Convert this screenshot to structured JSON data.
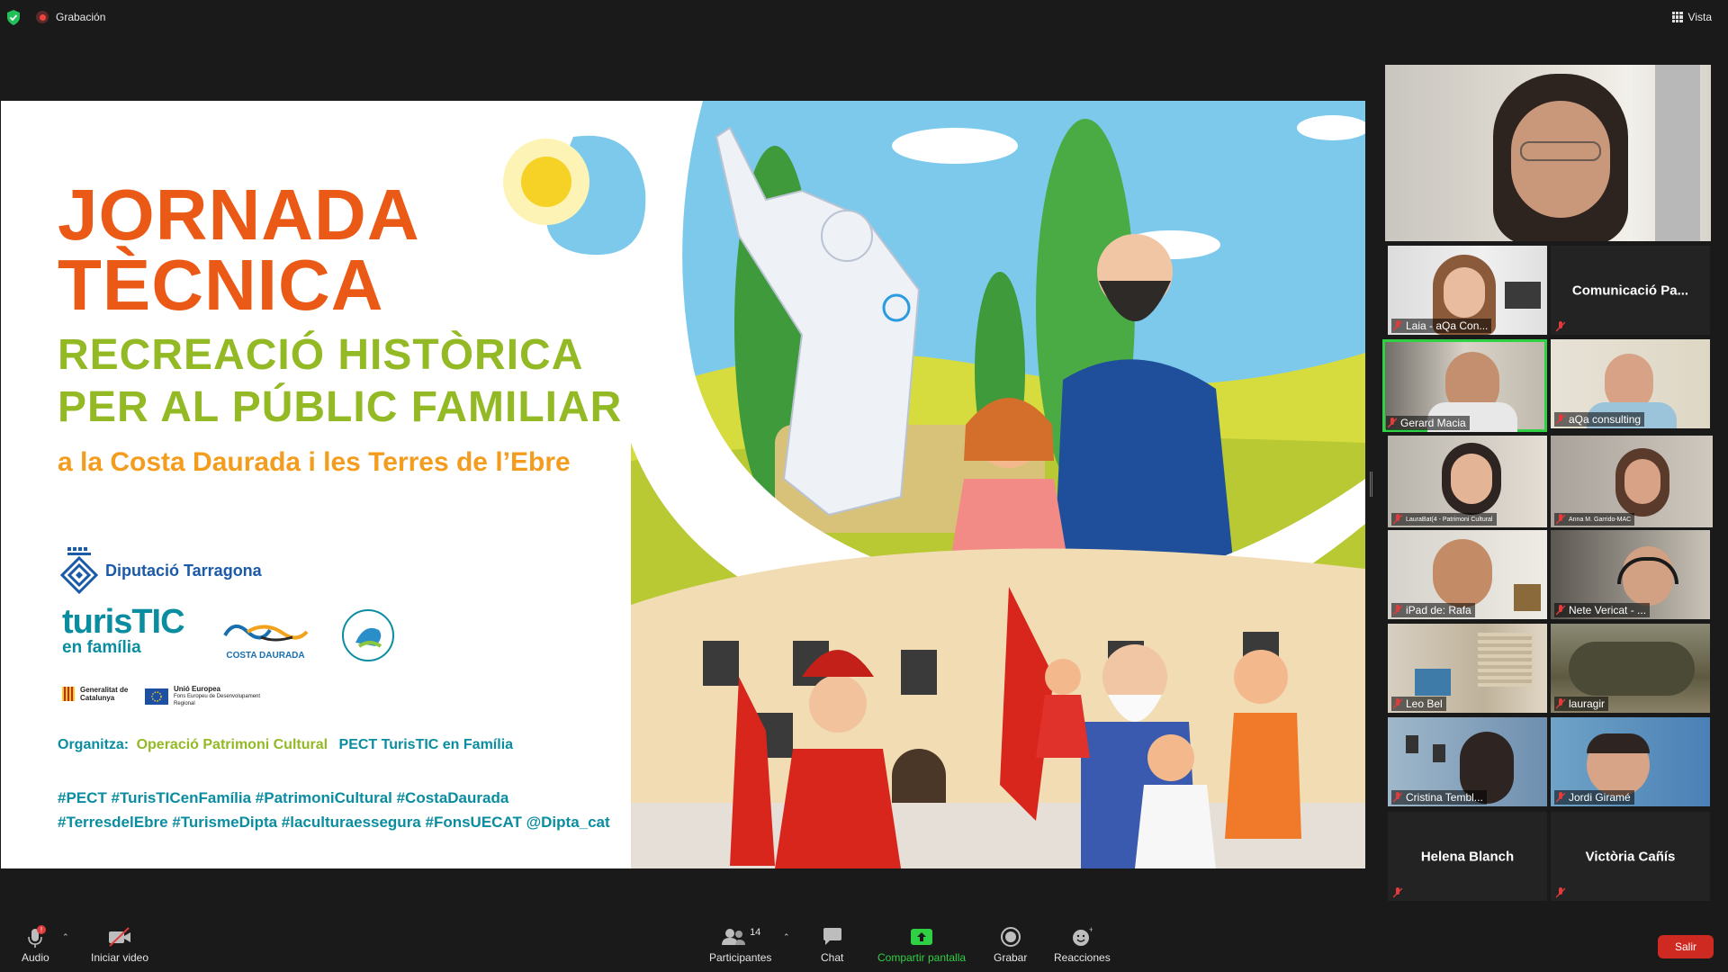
{
  "topbar": {
    "recording_label": "Grabación",
    "view_label": "Vista"
  },
  "slide": {
    "title_line1": "JORNADA",
    "title_line2": "TÈCNICA",
    "subtitle_line1": "RECREACIÓ HISTÒRICA",
    "subtitle_line2": "PER AL PÚBLIC FAMILIAR",
    "tagline": "a la Costa Daurada i les Terres de l’Ebre",
    "logos": {
      "diputacio": "Diputació Tarragona",
      "turistic_line1": "turisTIC",
      "turistic_line2": "en família",
      "costa_daurada": "COSTA DAURADA",
      "generalitat": "Generalitat de Catalunya",
      "ue_line1": "Unió Europea",
      "ue_line2": "Fons Europeu de Desenvolupament Regional"
    },
    "organitza_label": "Organitza:",
    "organitza_1": "Operació Patrimoni Cultural",
    "organitza_2": "PECT TurisTIC en Família",
    "hashtags_line1": "#PECT #TurisTICenFamília #PatrimoniCultural #CostaDaurada",
    "hashtags_line2": "#TerresdelEbre #TurismeDipta #laculturaessegura #FonsUECAT @Dipta_cat"
  },
  "participants": {
    "p0": "",
    "p1": "Laia - aQa Con...",
    "p2": "Comunicació Pa...",
    "p3": "Gerard Macia",
    "p4": "aQa consulting",
    "p5": "LauraBat(4 - Patrimoni Cultural",
    "p6": "Anna M. Garrido-MAC",
    "p7": "iPad de: Rafa",
    "p8": "Nete Vericat - ...",
    "p9": "Leo Bel",
    "p10": "lauragir",
    "p11": "Cristina Tembl...",
    "p12": "Jordi Giramé",
    "p13": "Helena Blanch",
    "p14": "Victòria Cañís"
  },
  "toolbar": {
    "audio": "Audio",
    "video": "Iniciar video",
    "participants": "Participantes",
    "participants_count": "14",
    "chat": "Chat",
    "share": "Compartir pantalla",
    "record": "Grabar",
    "reactions": "Reacciones",
    "leave": "Salir"
  },
  "colors": {
    "accent_orange": "#ea5a16",
    "accent_green": "#93b924",
    "teal": "#0a8da0",
    "leave_red": "#cf2a22",
    "share_green": "#2fd043"
  }
}
